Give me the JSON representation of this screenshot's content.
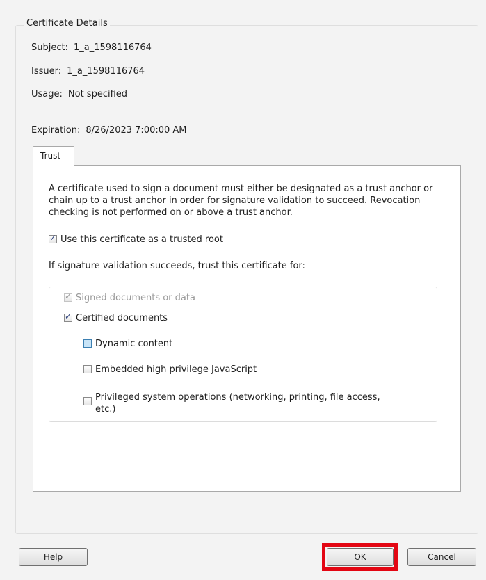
{
  "details": {
    "legend": "Certificate Details",
    "subject_label": "Subject:",
    "subject_value": "1_a_1598116764",
    "issuer_label": "Issuer:",
    "issuer_value": "1_a_1598116764",
    "usage_label": "Usage:",
    "usage_value": "Not specified",
    "expiration_label": "Expiration:",
    "expiration_value": "8/26/2023 7:00:00 AM"
  },
  "tabs": [
    {
      "label": "Trust",
      "active": true
    }
  ],
  "trust": {
    "description": "A certificate used to sign a document must either be designated as a trust anchor or chain up to a trust anchor in order for signature validation to succeed.  Revocation checking is not performed on or above a trust anchor.",
    "trusted_root": {
      "label": "Use this certificate as a trusted root",
      "checked": true
    },
    "trust_for_heading": "If signature validation succeeds, trust this certificate for:",
    "options": [
      {
        "label": "Signed documents or data",
        "checked": true,
        "disabled": true
      },
      {
        "label": "Certified documents",
        "checked": true,
        "disabled": false
      },
      {
        "label": "Dynamic content",
        "checked": false,
        "disabled": false
      },
      {
        "label": "Embedded high privilege JavaScript",
        "checked": false,
        "disabled": false
      },
      {
        "label": "Privileged system operations (networking, printing, file access,",
        "label_line2": "etc.)",
        "checked": false,
        "disabled": false
      }
    ]
  },
  "buttons": {
    "help": "Help",
    "ok": "OK",
    "cancel": "Cancel"
  },
  "colors": {
    "highlight": "#e30613",
    "dialog_bg": "#f3f3f3",
    "checkmark": "#2b3f7a"
  }
}
